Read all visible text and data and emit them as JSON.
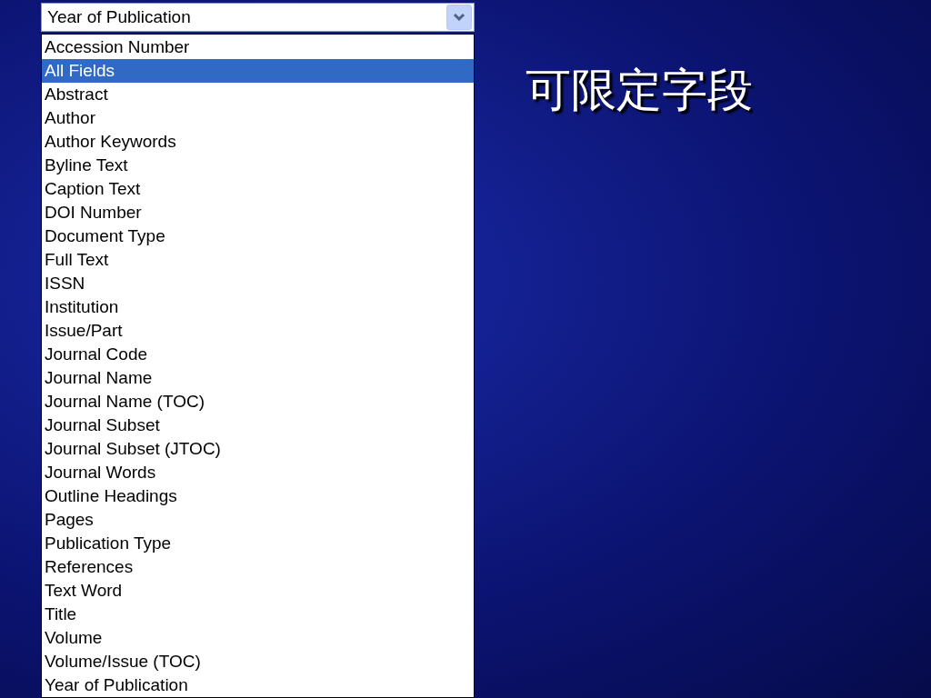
{
  "slide_title": "可限定字段",
  "dropdown": {
    "value": "Year of Publication",
    "options": [
      {
        "label": "Accession Number",
        "highlighted": false
      },
      {
        "label": "All Fields",
        "highlighted": true
      },
      {
        "label": "Abstract",
        "highlighted": false
      },
      {
        "label": "Author",
        "highlighted": false
      },
      {
        "label": "Author Keywords",
        "highlighted": false
      },
      {
        "label": "Byline Text",
        "highlighted": false
      },
      {
        "label": "Caption Text",
        "highlighted": false
      },
      {
        "label": "DOI Number",
        "highlighted": false
      },
      {
        "label": "Document Type",
        "highlighted": false
      },
      {
        "label": "Full Text",
        "highlighted": false
      },
      {
        "label": "ISSN",
        "highlighted": false
      },
      {
        "label": "Institution",
        "highlighted": false
      },
      {
        "label": "Issue/Part",
        "highlighted": false
      },
      {
        "label": "Journal Code",
        "highlighted": false
      },
      {
        "label": "Journal Name",
        "highlighted": false
      },
      {
        "label": "Journal Name (TOC)",
        "highlighted": false
      },
      {
        "label": "Journal Subset",
        "highlighted": false
      },
      {
        "label": "Journal Subset (JTOC)",
        "highlighted": false
      },
      {
        "label": "Journal Words",
        "highlighted": false
      },
      {
        "label": "Outline Headings",
        "highlighted": false
      },
      {
        "label": "Pages",
        "highlighted": false
      },
      {
        "label": "Publication Type",
        "highlighted": false
      },
      {
        "label": "References",
        "highlighted": false
      },
      {
        "label": "Text Word",
        "highlighted": false
      },
      {
        "label": "Title",
        "highlighted": false
      },
      {
        "label": "Volume",
        "highlighted": false
      },
      {
        "label": "Volume/Issue (TOC)",
        "highlighted": false
      },
      {
        "label": "Year of Publication",
        "highlighted": false
      }
    ]
  }
}
